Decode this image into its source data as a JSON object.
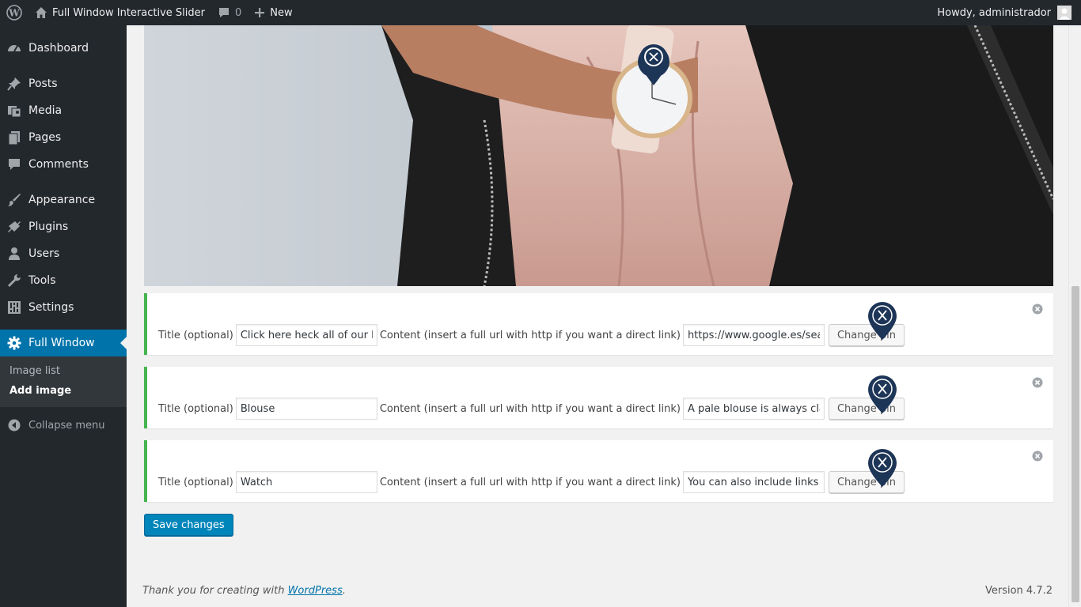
{
  "adminbar": {
    "site_name": "Full Window Interactive Slider",
    "comments_count": "0",
    "new_label": "New",
    "howdy": "Howdy, administrador"
  },
  "sidebar": {
    "items": [
      {
        "label": "Dashboard",
        "icon": "dashboard-icon"
      },
      {
        "label": "Posts",
        "icon": "pin-icon"
      },
      {
        "label": "Media",
        "icon": "media-icon"
      },
      {
        "label": "Pages",
        "icon": "pages-icon"
      },
      {
        "label": "Comments",
        "icon": "comment-icon"
      },
      {
        "label": "Appearance",
        "icon": "brush-icon"
      },
      {
        "label": "Plugins",
        "icon": "plugin-icon"
      },
      {
        "label": "Users",
        "icon": "user-icon"
      },
      {
        "label": "Tools",
        "icon": "wrench-icon"
      },
      {
        "label": "Settings",
        "icon": "settings-icon"
      },
      {
        "label": "Full Window",
        "icon": "gear-icon"
      }
    ],
    "submenu": [
      "Image list",
      "Add image"
    ],
    "collapse": "Collapse menu"
  },
  "pins": [
    {
      "title_label": "Title (optional)",
      "title_value": "Click here heck all of our le",
      "content_label": "Content (insert a full url with http if you want a direct link)",
      "content_value": "https://www.google.es/sea",
      "button": "Change pin"
    },
    {
      "title_label": "Title (optional)",
      "title_value": "Blouse",
      "content_label": "Content (insert a full url with http if you want a direct link)",
      "content_value": "A pale blouse is always cla",
      "button": "Change pin"
    },
    {
      "title_label": "Title (optional)",
      "title_value": "Watch",
      "content_label": "Content (insert a full url with http if you want a direct link)",
      "content_value": "You can also include links i",
      "button": "Change pin"
    }
  ],
  "save_label": "Save changes",
  "footer": {
    "thanks": "Thank you for creating with ",
    "link": "WordPress",
    "period": ".",
    "version": "Version 4.7.2"
  },
  "colors": {
    "adminbar_bg": "#23282d",
    "accent": "#0073aa",
    "pin_border": "#46b450",
    "pin_marker": "#1d3557",
    "primary_button": "#0085ba"
  }
}
